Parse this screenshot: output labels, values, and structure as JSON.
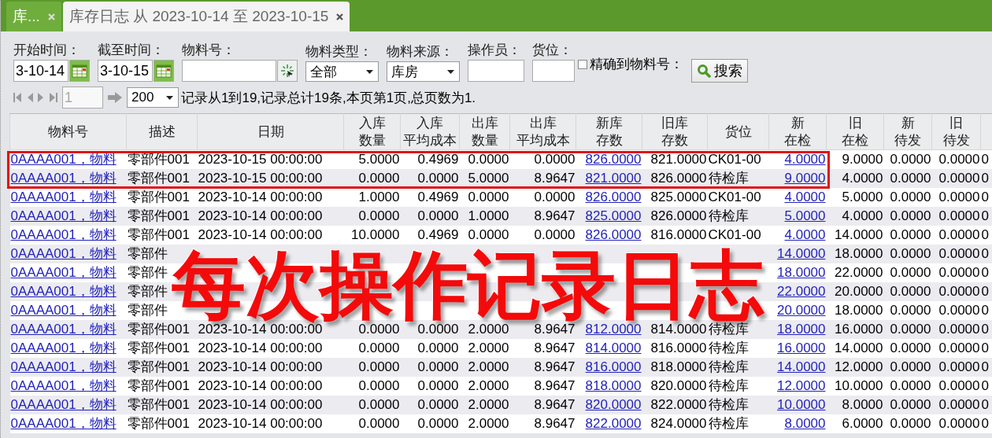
{
  "tabs": [
    {
      "label": "库...",
      "selected": false
    },
    {
      "label": "库存日志 从 2023-10-14 至 2023-10-15",
      "selected": true
    }
  ],
  "filters": {
    "start_time": {
      "label": "开始时间：",
      "value": "3-10-14"
    },
    "end_time": {
      "label": "截至时间：",
      "value": "3-10-15"
    },
    "material_no": {
      "label": "物料号："
    },
    "material_type": {
      "label": "物料类型：",
      "value": "全部"
    },
    "material_source": {
      "label": "物料来源：",
      "value": "库房"
    },
    "operator": {
      "label": "操作员："
    },
    "location": {
      "label": "货位："
    },
    "exact_match": {
      "label": "精确到物料号：",
      "checked": false
    },
    "search_button": "搜索"
  },
  "pager": {
    "page": "1",
    "page_size": "200",
    "summary": "记录从1到19,记录总计19条,本页第1页,总页数为1."
  },
  "table": {
    "columns": [
      {
        "lines": [
          "物料号"
        ],
        "kind": "link"
      },
      {
        "lines": [
          "描述"
        ],
        "kind": "text"
      },
      {
        "lines": [
          "日期"
        ],
        "kind": "text"
      },
      {
        "lines": [
          "入库",
          "数量"
        ],
        "kind": "number"
      },
      {
        "lines": [
          "入库",
          "平均成本"
        ],
        "kind": "number"
      },
      {
        "lines": [
          "出库",
          "数量"
        ],
        "kind": "number"
      },
      {
        "lines": [
          "出库",
          "平均成本"
        ],
        "kind": "number"
      },
      {
        "lines": [
          "新库",
          "存数"
        ],
        "kind": "link"
      },
      {
        "lines": [
          "旧库",
          "存数"
        ],
        "kind": "number"
      },
      {
        "lines": [
          "货位"
        ],
        "kind": "text"
      },
      {
        "lines": [
          "新",
          "在检"
        ],
        "kind": "link"
      },
      {
        "lines": [
          "旧",
          "在检"
        ],
        "kind": "number"
      },
      {
        "lines": [
          "新",
          "待发"
        ],
        "kind": "number"
      },
      {
        "lines": [
          "旧",
          "待发"
        ],
        "kind": "number"
      },
      {
        "kind": "text"
      }
    ],
    "rows": [
      [
        "0AAAA001，物料",
        "零部件001",
        "2023-10-15 00:00:00",
        "5.0000",
        "0.4969",
        "0.0000",
        "0.0000",
        "826.0000",
        "821.0000",
        "CK01-00",
        "4.0000",
        "9.0000",
        "0.0000",
        "0.0000",
        "0"
      ],
      [
        "0AAAA001，物料",
        "零部件001",
        "2023-10-15 00:00:00",
        "0.0000",
        "0.0000",
        "5.0000",
        "8.9647",
        "821.0000",
        "826.0000",
        "待检库",
        "9.0000",
        "4.0000",
        "0.0000",
        "0.0000",
        "0"
      ],
      [
        "0AAAA001，物料",
        "零部件001",
        "2023-10-14 00:00:00",
        "1.0000",
        "0.4969",
        "0.0000",
        "0.0000",
        "826.0000",
        "825.0000",
        "CK01-00",
        "4.0000",
        "5.0000",
        "0.0000",
        "0.0000",
        "0"
      ],
      [
        "0AAAA001，物料",
        "零部件001",
        "2023-10-14 00:00:00",
        "0.0000",
        "0.0000",
        "1.0000",
        "8.9647",
        "825.0000",
        "826.0000",
        "待检库",
        "5.0000",
        "4.0000",
        "0.0000",
        "0.0000",
        "0"
      ],
      [
        "0AAAA001，物料",
        "零部件001",
        "2023-10-14 00:00:00",
        "10.0000",
        "0.4969",
        "0.0000",
        "0.0000",
        "826.0000",
        "816.0000",
        "CK01-00",
        "4.0000",
        "14.0000",
        "0.0000",
        "0.0000",
        "0"
      ],
      [
        "0AAAA001，物料",
        "零部件",
        null,
        null,
        null,
        null,
        null,
        null,
        null,
        null,
        "14.0000",
        "18.0000",
        "0.0000",
        "0.0000",
        "0"
      ],
      [
        "0AAAA001，物料",
        "零部件",
        null,
        null,
        null,
        null,
        null,
        null,
        null,
        null,
        "18.0000",
        "22.0000",
        "0.0000",
        "0.0000",
        "0"
      ],
      [
        "0AAAA001，物料",
        "零部件",
        null,
        null,
        null,
        null,
        null,
        null,
        null,
        null,
        "22.0000",
        "20.0000",
        "0.0000",
        "0.0000",
        "0"
      ],
      [
        "0AAAA001，物料",
        "零部件",
        null,
        null,
        null,
        null,
        null,
        null,
        null,
        null,
        "20.0000",
        "18.0000",
        "0.0000",
        "0.0000",
        "0"
      ],
      [
        "0AAAA001，物料",
        "零部件001",
        "2023-10-14 00:00:00",
        "0.0000",
        "0.0000",
        "2.0000",
        "8.9647",
        "812.0000",
        "814.0000",
        "待检库",
        "18.0000",
        "16.0000",
        "0.0000",
        "0.0000",
        "0"
      ],
      [
        "0AAAA001，物料",
        "零部件001",
        "2023-10-14 00:00:00",
        "0.0000",
        "0.0000",
        "2.0000",
        "8.9647",
        "814.0000",
        "816.0000",
        "待检库",
        "16.0000",
        "14.0000",
        "0.0000",
        "0.0000",
        "0"
      ],
      [
        "0AAAA001，物料",
        "零部件001",
        "2023-10-14 00:00:00",
        "0.0000",
        "0.0000",
        "2.0000",
        "8.9647",
        "816.0000",
        "818.0000",
        "待检库",
        "14.0000",
        "12.0000",
        "0.0000",
        "0.0000",
        "0"
      ],
      [
        "0AAAA001，物料",
        "零部件001",
        "2023-10-14 00:00:00",
        "0.0000",
        "0.0000",
        "2.0000",
        "8.9647",
        "818.0000",
        "820.0000",
        "待检库",
        "12.0000",
        "10.0000",
        "0.0000",
        "0.0000",
        "0"
      ],
      [
        "0AAAA001，物料",
        "零部件001",
        "2023-10-14 00:00:00",
        "0.0000",
        "0.0000",
        "2.0000",
        "8.9647",
        "820.0000",
        "822.0000",
        "待检库",
        "10.0000",
        "8.0000",
        "0.0000",
        "0.0000",
        "0"
      ],
      [
        "0AAAA001，物料",
        "零部件001",
        "2023-10-14 00:00:00",
        "0.0000",
        "0.0000",
        "2.0000",
        "8.9647",
        "822.0000",
        "824.0000",
        "待检库",
        "8.0000",
        "6.0000",
        "0.0000",
        "0.0000",
        "0"
      ]
    ]
  },
  "overlay_caption": "每次操作记录日志"
}
